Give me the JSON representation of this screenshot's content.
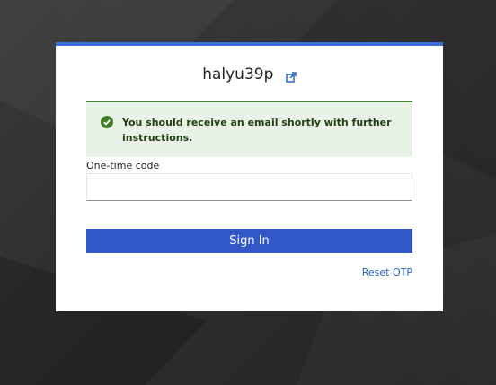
{
  "login": {
    "username": "halyu39p",
    "username_link_icon": "external-link-icon",
    "alert": {
      "icon": "check-circle-icon",
      "message": "You should receive an email shortly with further instructions."
    },
    "otp_label": "One-time code",
    "otp_value": "",
    "otp_placeholder": "",
    "sign_in_label": "Sign In",
    "reset_link_label": "Reset OTP"
  },
  "colors": {
    "accent": "#3d6fd9",
    "button": "#3258c8",
    "success_border": "#4a8a32",
    "success_bg": "#e9f2e6",
    "link": "#2a63c3"
  }
}
